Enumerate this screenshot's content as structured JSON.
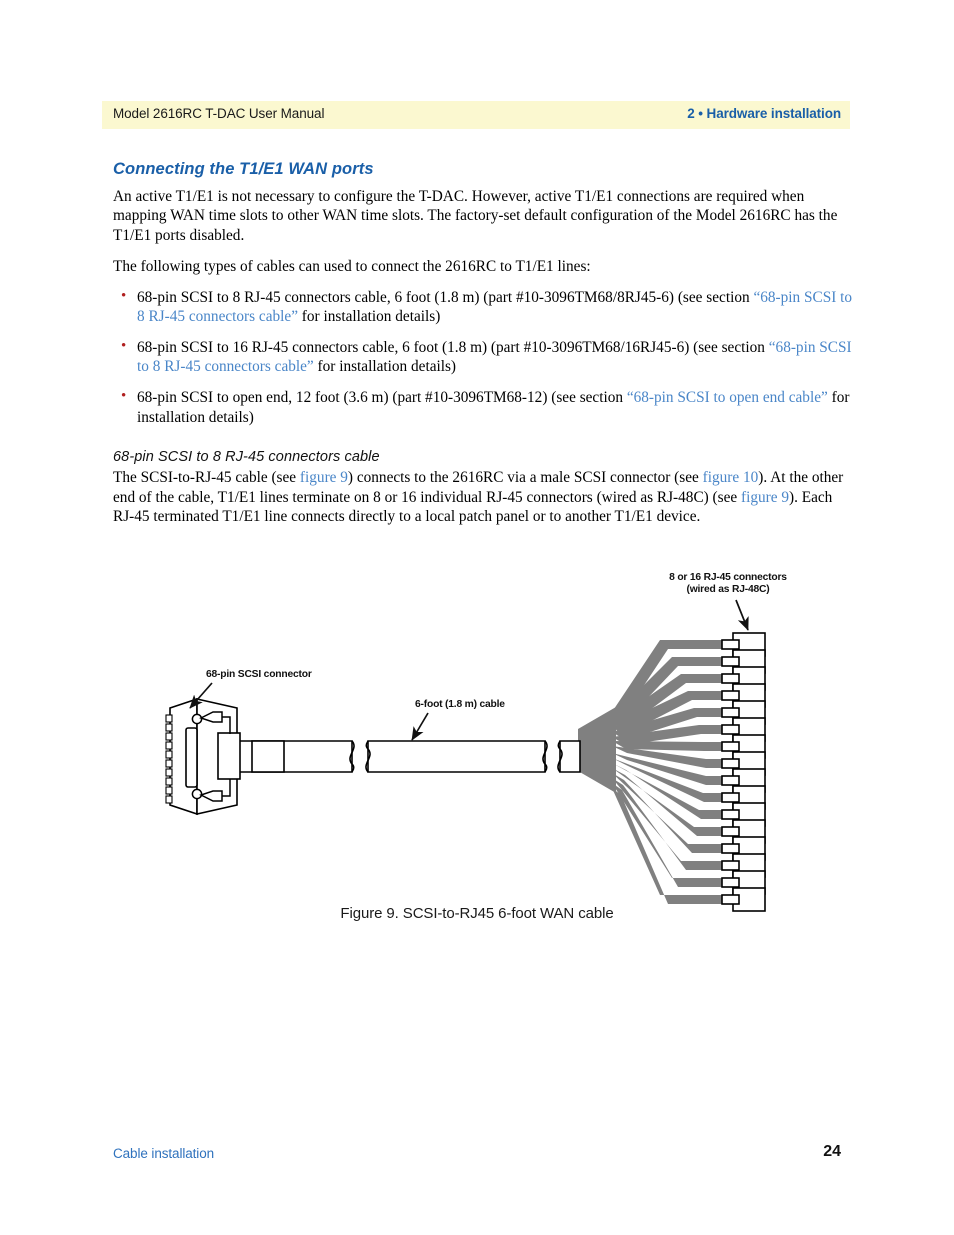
{
  "header": {
    "left": "Model 2616RC T-DAC User Manual",
    "right": "2 • Hardware installation",
    "band_color": "#fbf8d0",
    "right_color": "#1a5fa8"
  },
  "section": {
    "title": "Connecting the T1/E1 WAN ports",
    "intro": "An active T1/E1 is not necessary to configure the T-DAC. However, active T1/E1 connections are required when mapping WAN time slots to other WAN time slots. The factory-set default configuration of the Model 2616RC has the T1/E1 ports disabled.",
    "list_lead": "The following types of cables can used to connect the 2616RC to T1/E1 lines:"
  },
  "cable_list": [
    {
      "bullet": "•",
      "pre": "68-pin SCSI to 8 RJ-45 connectors cable, 6 foot (1.8 m) (part #10-3096TM68/8RJ45-6) (see section ",
      "link": "“68-pin SCSI to 8 RJ-45 connectors cable”",
      "post": " for installation details)"
    },
    {
      "bullet": "•",
      "pre": "68-pin SCSI to 16 RJ-45 connectors cable, 6 foot (1.8 m) (part #10-3096TM68/16RJ45-6) (see section ",
      "link": "“68-pin SCSI to 8 RJ-45 connectors cable”",
      "post": " for installation details)"
    },
    {
      "bullet": "•",
      "pre": "68-pin SCSI to open end, 12 foot (3.6 m) (part #10-3096TM68-12) (see section ",
      "link": "“68-pin SCSI to open end cable”",
      "post": " for installation details)"
    }
  ],
  "subsection": {
    "title": "68-pin SCSI to 8 RJ-45 connectors cable",
    "p1_a": "The SCSI-to-RJ-45 cable (see ",
    "p1_link1": "figure 9",
    "p1_b": ") connects to the 2616RC via a male SCSI connector (see ",
    "p1_link2": "figure 10",
    "p1_c": "). At the other end of the cable, T1/E1 lines terminate on 8 or 16 individual RJ-45 connectors (wired as RJ-48C) (see ",
    "p1_link3": "figure 9",
    "p1_d": "). Each RJ-45 terminated T1/E1 line connects directly to a local patch panel or to another T1/E1 device."
  },
  "figure": {
    "caption": "Figure 9. SCSI-to-RJ45 6-foot WAN cable",
    "label_scsi": "68-pin SCSI connector",
    "label_cable": "6-foot (1.8 m) cable",
    "label_rj45_line1": "8 or 16 RJ-45 connectors",
    "label_rj45_line2": "(wired as RJ-48C)",
    "connector_count": 16,
    "strand_color": "#808080",
    "outline_color": "#000000"
  },
  "footer": {
    "left": "Cable installation",
    "page": "24",
    "left_color": "#2f72bd"
  }
}
